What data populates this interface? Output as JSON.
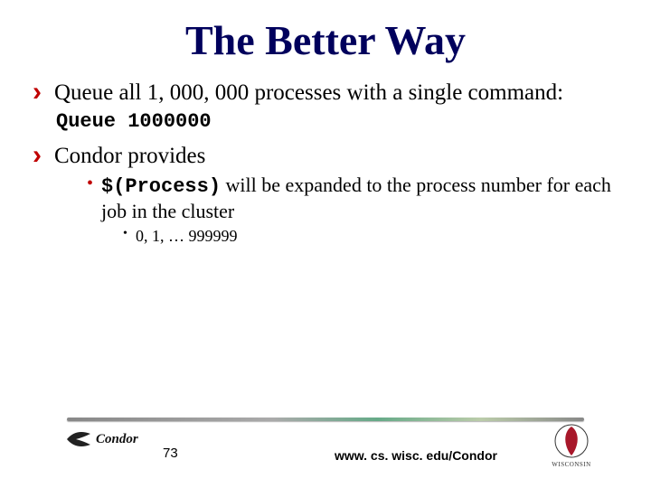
{
  "title": "The Better Way",
  "bullet1": "Queue all 1, 000, 000 processes with a single command:",
  "code1": "Queue 1000000",
  "bullet2": "Condor provides",
  "sub_code": "$(Process)",
  "sub_text": " will be expanded to the process number for each job in the cluster",
  "subsub": "0, 1, … 999999",
  "page_number": "73",
  "footer_url": "www. cs. wisc. edu/Condor",
  "condor_logo_text": "Condor",
  "wisc_logo_text": "WISCONSIN"
}
